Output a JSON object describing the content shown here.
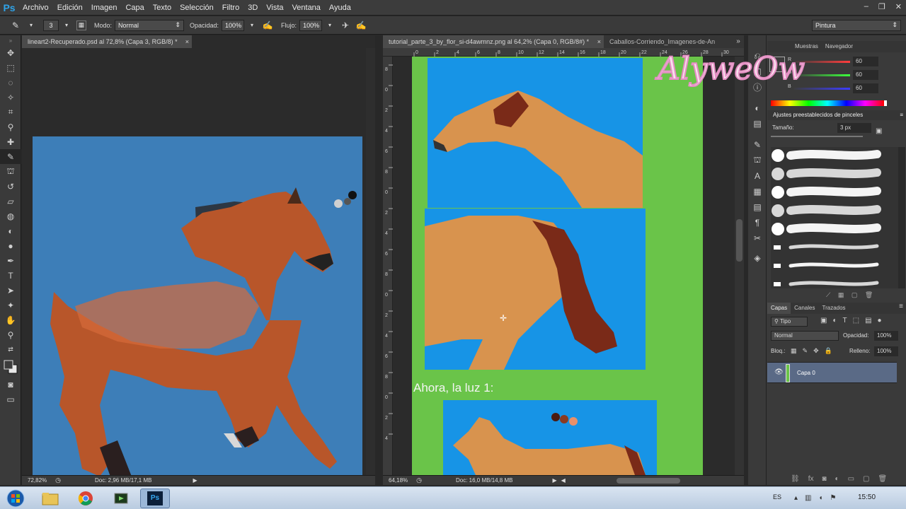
{
  "app": {
    "logo": "Ps"
  },
  "menu": [
    "Archivo",
    "Edición",
    "Imagen",
    "Capa",
    "Texto",
    "Selección",
    "Filtro",
    "3D",
    "Vista",
    "Ventana",
    "Ayuda"
  ],
  "window_controls": [
    "–",
    "❐",
    "✕"
  ],
  "options": {
    "brush_size": "3",
    "mode_label": "Modo:",
    "mode_value": "Normal",
    "opacity_label": "Opacidad:",
    "opacity_value": "100%",
    "flow_label": "Flujo:",
    "flow_value": "100%",
    "workspace": "Pintura"
  },
  "doc1": {
    "tab": "lineart2-Recuperado.psd al 72,8% (Capa 3, RGB/8) *",
    "zoom": "72,82%",
    "doc_info": "Doc: 2,96 MB/17,1 MB"
  },
  "doc2": {
    "tab_active": "tutorial_parte_3_by_flor_si-d4awmnz.png al 64,2% (Capa 0, RGB/8#) *",
    "tab_other": "Caballos-Corriendo_Imagenes-de-An",
    "zoom": "64,18%",
    "doc_info": "Doc: 16,0 MB/14,8 MB",
    "caption": "Ahora, la luz 1:",
    "ruler_top": [
      "0",
      "2",
      "4",
      "6",
      "8",
      "10",
      "12",
      "14",
      "16",
      "18",
      "20",
      "22",
      "24",
      "26",
      "28",
      "30"
    ],
    "ruler_left": [
      "8",
      "0",
      "2",
      "4",
      "6",
      "8",
      "0",
      "2",
      "4",
      "6",
      "8",
      "0",
      "2",
      "4",
      "6",
      "8",
      "0",
      "2",
      "4"
    ]
  },
  "watermark": "AlyweOw",
  "color_panel": {
    "tabs": [
      "Muestras",
      "Navegador"
    ],
    "r_label": "R",
    "g_label": "G",
    "b_label": "B",
    "r": "60",
    "g": "60",
    "b": "60"
  },
  "brush_panel": {
    "title": "Ajustes preestablecidos de pinceles",
    "size_label": "Tamaño:",
    "size_value": "3 px"
  },
  "layers_panel": {
    "tabs": [
      "Capas",
      "Canales",
      "Trazados"
    ],
    "kind_filter": "Tipo",
    "blend_mode": "Normal",
    "opacity_label": "Opacidad:",
    "opacity_value": "100%",
    "lock_label": "Bloq.:",
    "fill_label": "Relleno:",
    "fill_value": "100%",
    "layers": [
      {
        "name": "Capa 0"
      }
    ]
  },
  "taskbar": {
    "lang": "ES",
    "clock": "15:50"
  },
  "colors": {
    "doc1_bg": "#3d7eb8",
    "doc2_green": "#6ac449",
    "doc2_blue": "#1794e6",
    "horse_bay": "#b8562a",
    "horse_buckskin": "#d8934e",
    "watermark": "#e48ec3"
  }
}
